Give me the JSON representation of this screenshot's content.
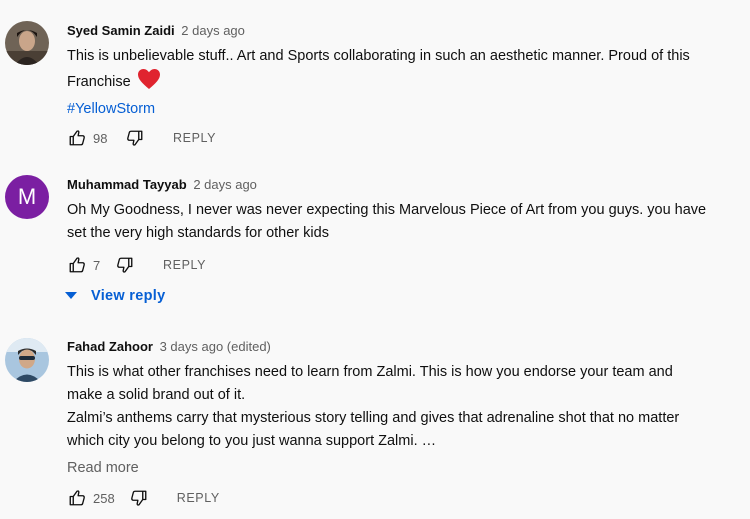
{
  "comments": [
    {
      "author": "Syed Samin Zaidi",
      "time": "2 days ago",
      "text_lines": [
        "This is unbelievable stuff.. Art and Sports collaborating in such an aesthetic manner. Proud of this",
        "Franchise"
      ],
      "hashtag": "#YellowStorm",
      "likes": "98",
      "reply_label": "REPLY",
      "emoji_icon": "red-heart-icon"
    },
    {
      "author": "Muhammad Tayyab",
      "time": "2 days ago",
      "avatar_letter": "M",
      "avatar_color": "#7b1fa2",
      "text_lines": [
        "Oh My Goodness, I never was never expecting this Marvelous Piece of Art from you guys. you have",
        "set the very high standards for other kids"
      ],
      "likes": "7",
      "reply_label": "REPLY",
      "view_reply_label": "View reply"
    },
    {
      "author": "Fahad Zahoor",
      "time": "3 days ago (edited)",
      "text_lines": [
        "This is what other franchises need to learn from Zalmi. This is how you endorse your team and",
        "make a solid brand out of it.",
        "Zalmi’s anthems carry that mysterious story telling and gives that adrenaline shot that no matter",
        "which city you belong to you just wanna support Zalmi. …"
      ],
      "read_more_label": "Read more",
      "likes": "258",
      "reply_label": "REPLY"
    }
  ],
  "colors": {
    "background": "#f9f9f9",
    "link": "#065fd4",
    "secondary_text": "#606060",
    "heart": "#e0242f"
  }
}
